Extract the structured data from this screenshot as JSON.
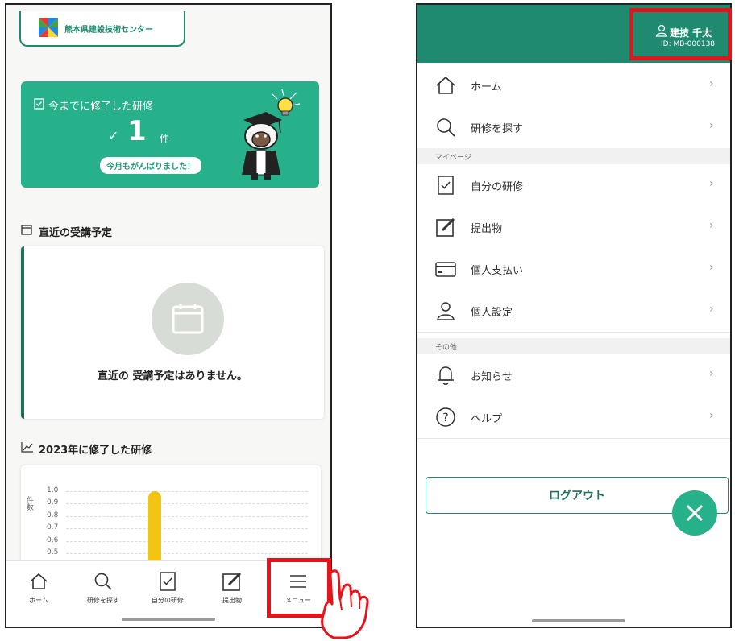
{
  "left": {
    "logo_text": "熊本県建設技術センター",
    "hero": {
      "title": "今までに修了した研修",
      "count": "1",
      "check": "✓",
      "unit": "件",
      "badge": "今月もがんばりました！"
    },
    "schedule": {
      "title": "直近の受講予定",
      "empty_text": "直近の 受講予定はありません。"
    },
    "chart_section_title": "2023年に修了した研修",
    "chart_data": {
      "type": "bar",
      "ylabel": "件数",
      "yticks": [
        "1.0",
        "0.9",
        "0.8",
        "0.7",
        "0.6",
        "0.5"
      ],
      "ylim": [
        0,
        1.0
      ],
      "values": [
        1.0
      ],
      "bar_color": "#f2c515"
    },
    "nav": [
      {
        "label": "ホーム",
        "icon": "home-icon"
      },
      {
        "label": "研修を探す",
        "icon": "search-icon"
      },
      {
        "label": "自分の研修",
        "icon": "bookmark-icon"
      },
      {
        "label": "提出物",
        "icon": "edit-icon"
      },
      {
        "label": "メニュー",
        "icon": "menu-icon"
      }
    ]
  },
  "right": {
    "user": {
      "name": "建技 千太",
      "id": "ID: MB-000138"
    },
    "items_top": [
      {
        "label": "ホーム",
        "icon": "home-icon"
      },
      {
        "label": "研修を探す",
        "icon": "search-icon"
      }
    ],
    "section_mypage": "マイページ",
    "items_mypage": [
      {
        "label": "自分の研修",
        "icon": "bookmark-icon"
      },
      {
        "label": "提出物",
        "icon": "edit-icon"
      },
      {
        "label": "個人支払い",
        "icon": "card-icon"
      },
      {
        "label": "個人設定",
        "icon": "user-icon"
      }
    ],
    "section_other": "その他",
    "items_other": [
      {
        "label": "お知らせ",
        "icon": "bell-icon"
      },
      {
        "label": "ヘルプ",
        "icon": "help-icon"
      }
    ],
    "logout": "ログアウト",
    "chevron": "›"
  },
  "colors": {
    "brand": "#1f8a70",
    "accent": "#27b18a",
    "highlight": "#e8121b",
    "bar": "#f2c515"
  }
}
